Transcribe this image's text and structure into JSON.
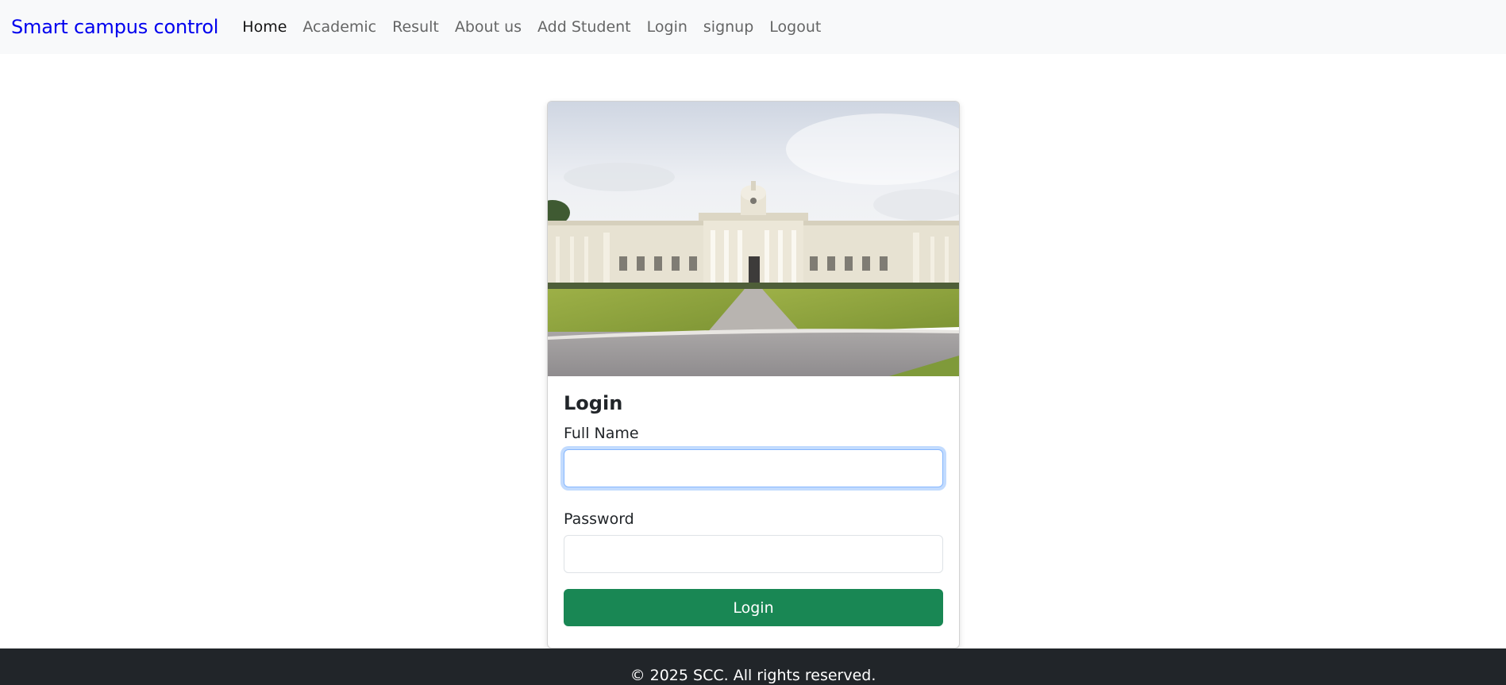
{
  "navbar": {
    "brand": "Smart campus control",
    "links": [
      {
        "label": "Home",
        "active": true
      },
      {
        "label": "Academic"
      },
      {
        "label": "Result"
      },
      {
        "label": "About us"
      },
      {
        "label": "Add Student"
      },
      {
        "label": "Login"
      },
      {
        "label": "signup"
      },
      {
        "label": "Logout"
      }
    ]
  },
  "card": {
    "image_subject": "campus-main-building-photo",
    "title": "Login",
    "full_name_label": "Full Name",
    "full_name_value": "",
    "password_label": "Password",
    "password_value": "",
    "submit_label": "Login"
  },
  "footer": {
    "text": "© 2025 SCC. All rights reserved."
  },
  "colors": {
    "brand": "#0000ee",
    "navbar_bg": "#f8f9fa",
    "button_green": "#198754",
    "footer_bg": "#212529",
    "focus_ring": "#86b7fe"
  }
}
